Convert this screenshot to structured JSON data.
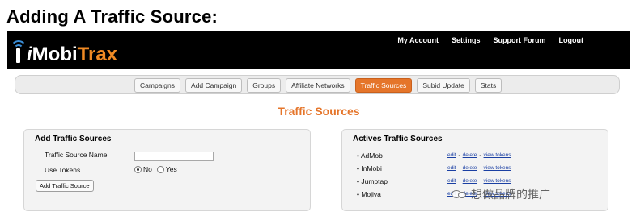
{
  "caption": "Adding A Traffic Source:",
  "logo": {
    "i": "i",
    "mobi": "Mobi",
    "trax": "Trax"
  },
  "top_nav": [
    "My Account",
    "Settings",
    "Support Forum",
    "Logout"
  ],
  "tabs": [
    {
      "label": "Campaigns",
      "active": false
    },
    {
      "label": "Add Campaign",
      "active": false
    },
    {
      "label": "Groups",
      "active": false
    },
    {
      "label": "Affiliate Networks",
      "active": false
    },
    {
      "label": "Traffic Sources",
      "active": true
    },
    {
      "label": "Subid Update",
      "active": false
    },
    {
      "label": "Stats",
      "active": false
    }
  ],
  "page_title": "Traffic Sources",
  "add_panel": {
    "title": "Add Traffic Sources",
    "name_label": "Traffic Source Name",
    "name_value": "",
    "tokens_label": "Use Tokens",
    "tokens_options": [
      "No",
      "Yes"
    ],
    "tokens_selected": "No",
    "button_label": "Add Traffic Source"
  },
  "active_panel": {
    "title": "Actives Traffic Sources",
    "items": [
      {
        "name": "• AdMob"
      },
      {
        "name": "• InMobi"
      },
      {
        "name": "• Jumptap"
      },
      {
        "name": "• Mojiva"
      }
    ],
    "actions": {
      "edit": "edit",
      "delete": "delete",
      "view": "view tokens",
      "sep": "-"
    }
  },
  "watermark": "想做品牌的推广",
  "colors": {
    "accent": "#e5752a",
    "topbar": "#000000",
    "link": "#1a3fa3"
  }
}
